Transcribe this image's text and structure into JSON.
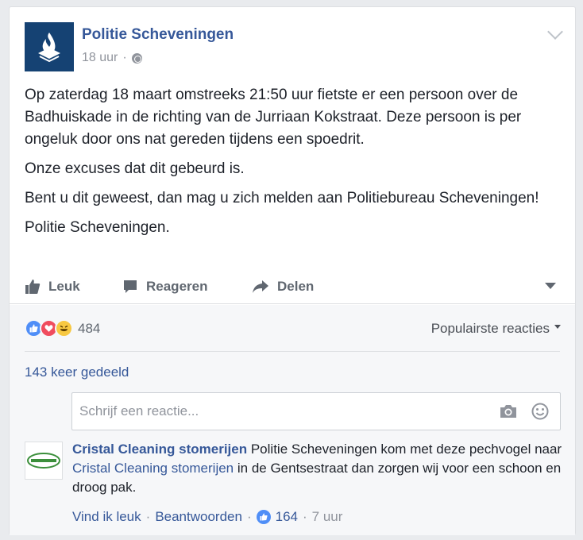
{
  "post": {
    "page_name": "Politie Scheveningen",
    "time": "18 uur",
    "separator": "·",
    "audience_icon": "globe-icon",
    "paragraphs": [
      "Op zaterdag 18 maart omstreeks 21:50 uur fietste er een persoon over de Badhuiskade in de richting van de Jurriaan Kokstraat. Deze persoon is per ongeluk door ons nat gereden tijdens een spoedrit.",
      "Onze excuses dat dit gebeurd is.",
      "Bent u dit geweest, dan mag u zich melden aan Politiebureau Scheveningen!",
      "Politie Scheveningen."
    ]
  },
  "actions": {
    "like_label": "Leuk",
    "comment_label": "Reageren",
    "share_label": "Delen"
  },
  "reactions": {
    "icons": [
      "like-icon",
      "love-icon",
      "haha-icon"
    ],
    "count": "484",
    "sort_label": "Populairste reacties"
  },
  "shares": "143 keer gedeeld",
  "comment_box": {
    "placeholder": "Schrijf een reactie..."
  },
  "comment": {
    "author": "Cristal Cleaning stomerijen",
    "text_part1": " Politie Scheveningen kom met deze pechvogel naar ",
    "tag": "Cristal Cleaning stomerijen",
    "text_part2": " in de Gentsestraat dan zorgen wij voor een schoon en droog pak.",
    "like_link": "Vind ik leuk",
    "reply_link": "Beantwoorden",
    "separator": "·",
    "like_count": "164",
    "time": "7 uur",
    "avatar_logo_text": "Cristal Cleaning"
  },
  "colors": {
    "brand_blue": "#365899",
    "police_blue": "#154273",
    "like_blue": "#4f8ef7",
    "love_red": "#f04c5e",
    "haha_yellow": "#f7c842"
  }
}
